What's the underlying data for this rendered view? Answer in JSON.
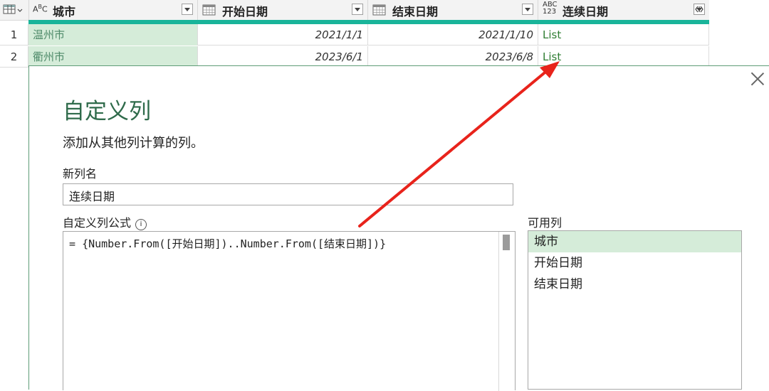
{
  "table": {
    "columns": [
      {
        "type": "ABC",
        "name": "城市"
      },
      {
        "type": "date",
        "name": "开始日期"
      },
      {
        "type": "date",
        "name": "结束日期"
      },
      {
        "type": "ABC123",
        "name": "连续日期"
      }
    ],
    "rows": [
      {
        "num": "1",
        "city": "温州市",
        "start": "2021/1/1",
        "end": "2021/1/10",
        "list": "List"
      },
      {
        "num": "2",
        "city": "衢州市",
        "start": "2023/6/1",
        "end": "2023/6/8",
        "list": "List"
      }
    ]
  },
  "dialog": {
    "title": "自定义列",
    "subtitle": "添加从其他列计算的列。",
    "new_col_label": "新列名",
    "new_col_value": "连续日期",
    "formula_label": "自定义列公式",
    "formula_prefix": "= ",
    "formula_text": "{Number.From([开始日期])..Number.From([结束日期])}",
    "available_label": "可用列",
    "available_columns": [
      "城市",
      "开始日期",
      "结束日期"
    ],
    "arrow_color": "#e8231b"
  }
}
